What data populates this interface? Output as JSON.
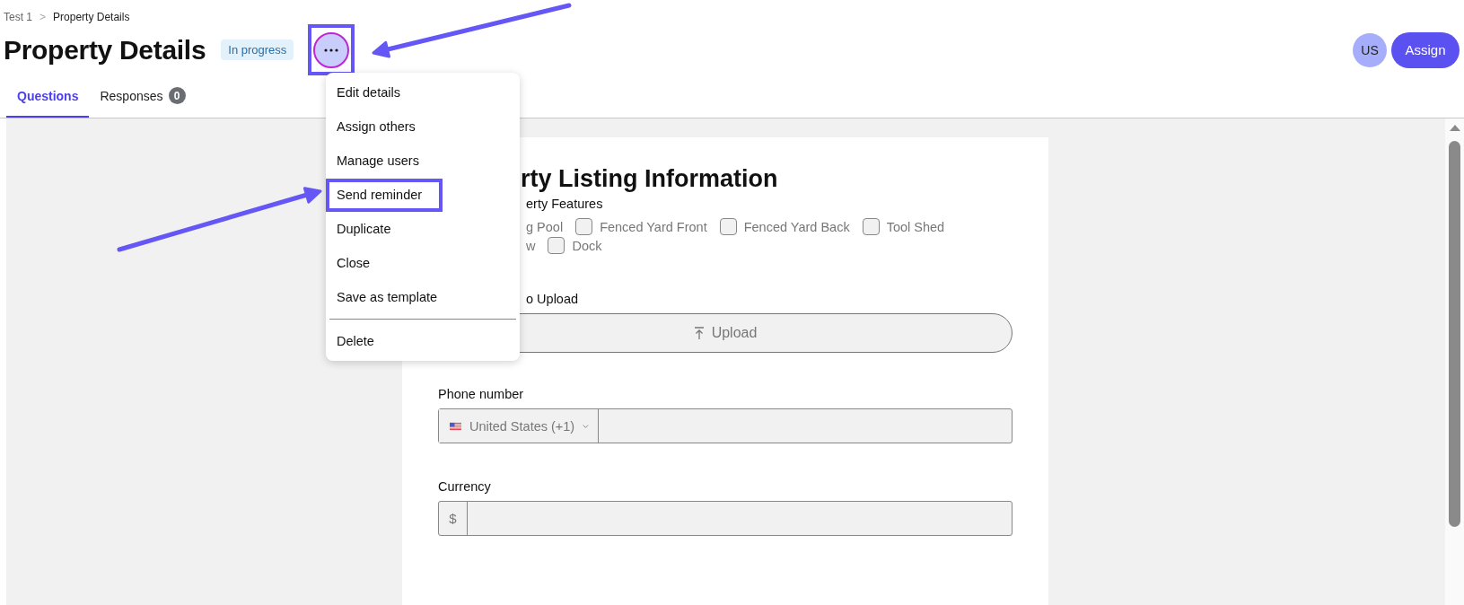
{
  "breadcrumb": {
    "items": [
      "Test 1",
      "Property Details"
    ],
    "separator": ">"
  },
  "page": {
    "title": "Property Details",
    "status": "In progress"
  },
  "more_button": {
    "annotated": true
  },
  "header_actions": {
    "avatar": "US",
    "assign_button": "Assign"
  },
  "tabs": [
    {
      "label": "Questions",
      "selected": true
    },
    {
      "label": "Responses",
      "selected": false,
      "count": "0"
    }
  ],
  "menu": {
    "items": [
      {
        "label": "Edit details",
        "annotated": false
      },
      {
        "label": "Assign others",
        "annotated": false
      },
      {
        "label": "Manage users",
        "annotated": false
      },
      {
        "label": "Send reminder",
        "annotated": true
      },
      {
        "label": "Duplicate",
        "annotated": false
      },
      {
        "label": "Close",
        "annotated": false
      },
      {
        "label": "Save as template",
        "annotated": false
      }
    ],
    "footer_items": [
      {
        "label": "Delete",
        "annotated": false
      }
    ]
  },
  "form": {
    "title": "rty Listing Information",
    "features": {
      "label": "erty Features",
      "rows": [
        [
          {
            "kind": "text",
            "label": "g Pool"
          },
          {
            "kind": "checkbox",
            "label": "Fenced Yard Front",
            "checked": false
          },
          {
            "kind": "checkbox",
            "label": "Fenced Yard Back",
            "checked": false
          },
          {
            "kind": "checkbox",
            "label": "Tool Shed",
            "checked": false
          }
        ],
        [
          {
            "kind": "text",
            "label": "w"
          },
          {
            "kind": "checkbox",
            "label": "Dock",
            "checked": false
          }
        ]
      ]
    },
    "upload": {
      "label": "o Upload",
      "button": "Upload"
    },
    "phone": {
      "label": "Phone number",
      "country": "United States (+1)"
    },
    "currency": {
      "label": "Currency",
      "symbol": "$"
    }
  }
}
